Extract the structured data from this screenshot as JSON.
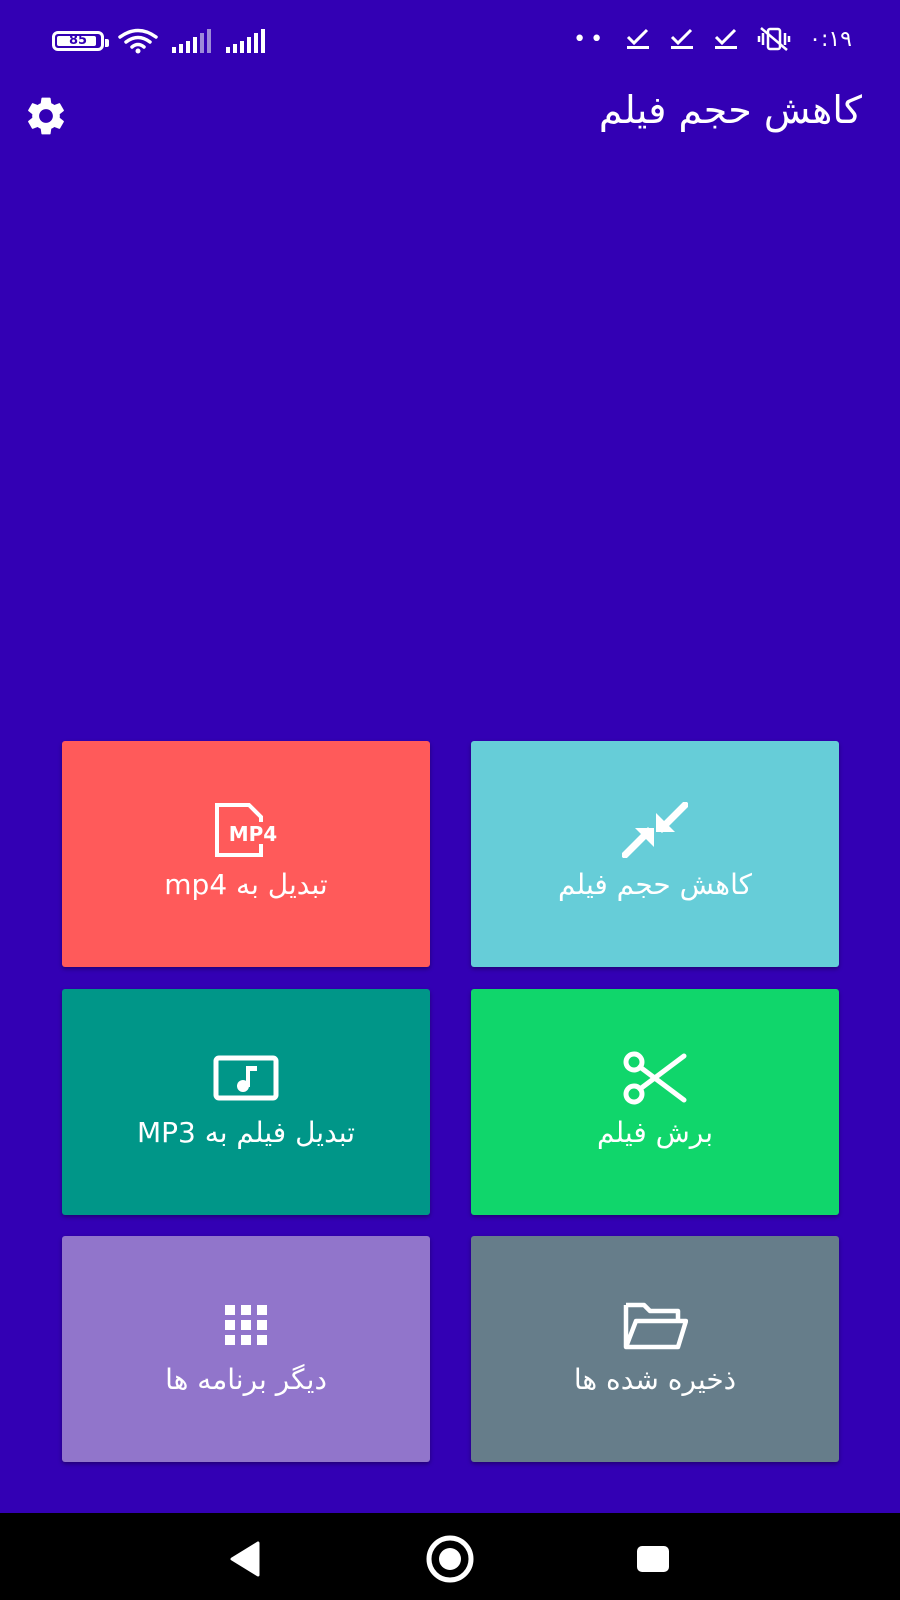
{
  "status_bar": {
    "battery_level": "85",
    "battery_fraction": 0.85,
    "time": "۰:۱۹",
    "dots": "••",
    "icons": [
      "battery-icon",
      "wifi-icon",
      "signal-icon",
      "signal-icon",
      "check-icon",
      "check-icon",
      "check-icon",
      "vibrate-off-icon"
    ]
  },
  "app_bar": {
    "title": "کاهش حجم فیلم",
    "settings_icon": "gear-icon"
  },
  "tiles": [
    {
      "label": "کاهش حجم فیلم",
      "icon": "compress-icon",
      "color": "#66cdd8"
    },
    {
      "label": "تبدیل به mp4",
      "icon": "mp4-file-icon",
      "color": "#ff5a5a"
    },
    {
      "label": "برش فیلم",
      "icon": "scissors-icon",
      "color": "#10d66b"
    },
    {
      "label": "تبدیل فیلم به MP3",
      "icon": "music-video-icon",
      "color": "#009688"
    },
    {
      "label": "ذخیره شده ها",
      "icon": "folder-open-icon",
      "color": "#667d8a"
    },
    {
      "label": "دیگر برنامه ها",
      "icon": "apps-grid-icon",
      "color": "#9175cb"
    }
  ],
  "nav_bar": {
    "icons": [
      "back-icon",
      "home-icon",
      "recents-icon"
    ]
  },
  "colors": {
    "background": "#3300b4",
    "nav_bar": "#000000"
  }
}
